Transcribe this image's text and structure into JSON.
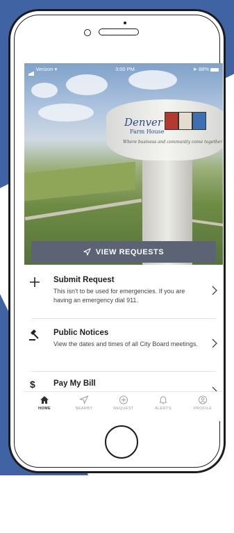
{
  "status_bar": {
    "carrier": "Verizon",
    "time": "3:00 PM",
    "battery": "88%"
  },
  "hero": {
    "tank_name": "Denver",
    "tank_subtitle": "Farm House",
    "tank_tagline": "Where business and community come together"
  },
  "view_requests": {
    "label": "VIEW REQUESTS",
    "icon": "paper-plane-icon"
  },
  "menu": [
    {
      "title": "Submit Request",
      "description": "This isn't to be used for emergencies. If you are having an emergency dial 911.",
      "icon": "plus-icon"
    },
    {
      "title": "Public Notices",
      "description": "View the dates and times of all City Board meetings.",
      "icon": "gavel-icon"
    },
    {
      "title": "Pay My Bill",
      "description": "",
      "icon": "dollar-icon"
    }
  ],
  "tabs": [
    {
      "label": "HOME",
      "icon": "home-icon",
      "active": true
    },
    {
      "label": "NEARBY",
      "icon": "navigation-icon",
      "active": false
    },
    {
      "label": "REQUEST",
      "icon": "plus-circle-icon",
      "active": false
    },
    {
      "label": "ALERTS",
      "icon": "bell-icon",
      "active": false
    },
    {
      "label": "PROFILE",
      "icon": "user-circle-icon",
      "active": false
    }
  ],
  "colors": {
    "background_blue": "#3f63a3",
    "button": "#5b6374",
    "tab_inactive": "#9a9a9a"
  }
}
